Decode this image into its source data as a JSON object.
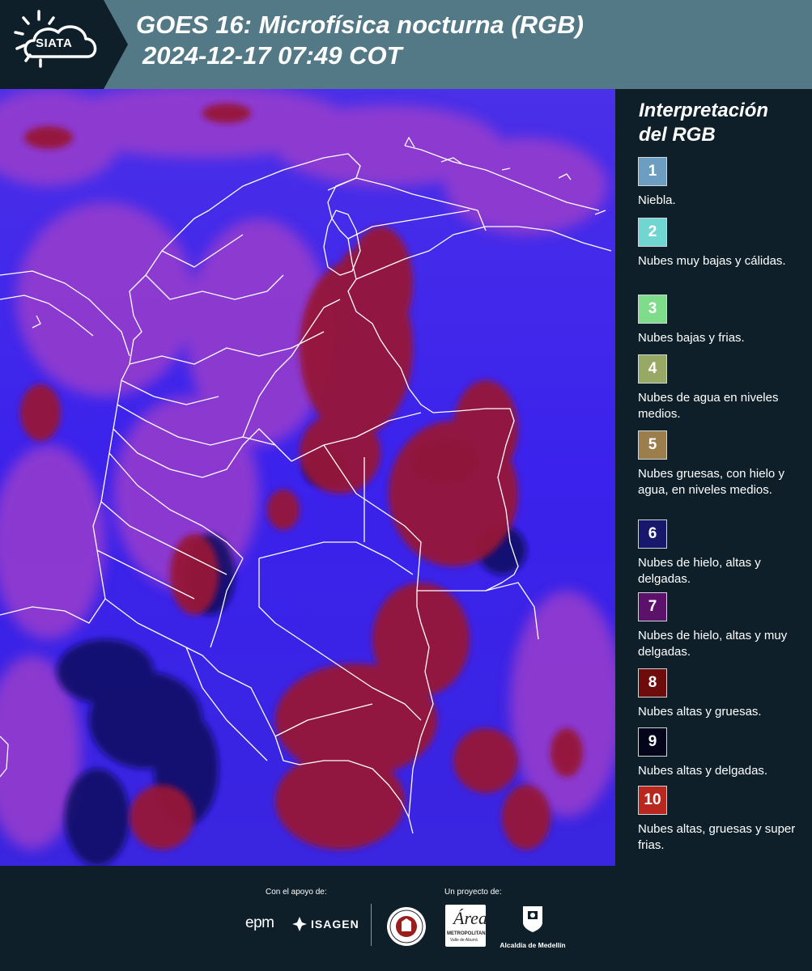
{
  "header": {
    "logo_text": "SIATA",
    "title_line1": "GOES 16: Microfísica nocturna (RGB)",
    "title_line2": "2024-12-17 07:49 COT"
  },
  "legend": {
    "title_line1": "Interpretación",
    "title_line2": "del RGB",
    "items": [
      {
        "number": "1",
        "label": "Niebla.",
        "color": "#6e9dc2"
      },
      {
        "number": "2",
        "label": "Nubes muy bajas y cálidas.",
        "color": "#71d6d2"
      },
      {
        "number": "3",
        "label": "Nubes bajas y frias.",
        "color": "#7fdc8b"
      },
      {
        "number": "4",
        "label": "Nubes de agua en niveles medios.",
        "color": "#97a964"
      },
      {
        "number": "5",
        "label": "Nubes gruesas, con hielo y agua, en niveles medios.",
        "color": "#9c7e4c"
      },
      {
        "number": "6",
        "label": "Nubes de hielo, altas y delgadas.",
        "color": "#17186b"
      },
      {
        "number": "7",
        "label": "Nubes de hielo, altas y muy delgadas.",
        "color": "#5c116b"
      },
      {
        "number": "8",
        "label": "Nubes altas y gruesas.",
        "color": "#6e0b0b"
      },
      {
        "number": "9",
        "label": "Nubes altas y delgadas.",
        "color": "#04041a"
      },
      {
        "number": "10",
        "label": "Nubes altas, gruesas y super frias.",
        "color": "#b8281e"
      }
    ]
  },
  "footer": {
    "support_label": "Con el apoyo de:",
    "project_label": "Un proyecto de:",
    "partners": {
      "epm": "epm",
      "isagen": "ISAGEN",
      "area_metro_mark": "Área",
      "area_metro_name": "METROPOLITANA",
      "area_metro_sub": "Valle de Aburrá",
      "alcaldia": "Alcaldía de Medellín"
    }
  },
  "map": {
    "palette": {
      "background": "#3a25e6",
      "thin_ice_cloud": "#9a3dcc",
      "thick_high_cloud": "#961437",
      "high_thin_dark": "#0d0f5e",
      "borders": "#ffffff"
    }
  }
}
